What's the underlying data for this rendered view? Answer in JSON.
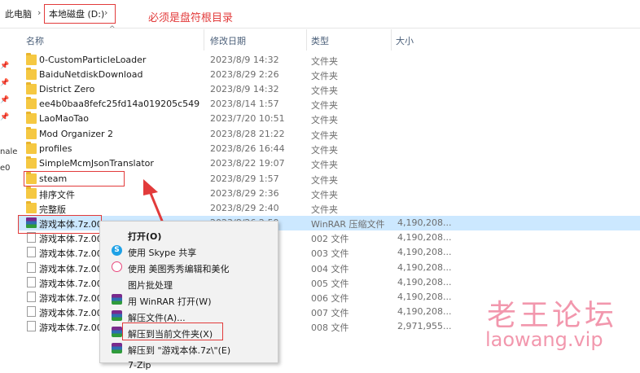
{
  "breadcrumb": {
    "items": [
      "此电脑",
      "本地磁盘 (D:)"
    ]
  },
  "annotation": {
    "note": "必须是盘符根目录"
  },
  "columns": {
    "name": "名称",
    "date": "修改日期",
    "type": "类型",
    "size": "大小"
  },
  "left_nav": {
    "text_1": "nale",
    "text_2": "e0"
  },
  "files": [
    {
      "name": "0-CustomParticleLoader",
      "date": "2023/8/9 14:32",
      "type": "文件夹",
      "size": "",
      "icon": "folder-icon"
    },
    {
      "name": "BaiduNetdiskDownload",
      "date": "2023/8/29 2:26",
      "type": "文件夹",
      "size": "",
      "icon": "folder-icon"
    },
    {
      "name": "District Zero",
      "date": "2023/8/9 14:32",
      "type": "文件夹",
      "size": "",
      "icon": "folder-icon"
    },
    {
      "name": "ee4b0baa8fefc25fd14a019205c549",
      "date": "2023/8/14 1:57",
      "type": "文件夹",
      "size": "",
      "icon": "folder-icon"
    },
    {
      "name": "LaoMaoTao",
      "date": "2023/7/20 10:51",
      "type": "文件夹",
      "size": "",
      "icon": "folder-icon"
    },
    {
      "name": "Mod Organizer 2",
      "date": "2023/8/28 21:22",
      "type": "文件夹",
      "size": "",
      "icon": "folder-icon"
    },
    {
      "name": "profiles",
      "date": "2023/8/26 16:44",
      "type": "文件夹",
      "size": "",
      "icon": "folder-icon"
    },
    {
      "name": "SimpleMcmJsonTranslator",
      "date": "2023/8/22 19:07",
      "type": "文件夹",
      "size": "",
      "icon": "folder-icon"
    },
    {
      "name": "steam",
      "date": "2023/8/29 1:57",
      "type": "文件夹",
      "size": "",
      "icon": "folder-icon"
    },
    {
      "name": "排序文件",
      "date": "2023/8/29 2:36",
      "type": "文件夹",
      "size": "",
      "icon": "folder-icon"
    },
    {
      "name": "完整版",
      "date": "2023/8/29 2:40",
      "type": "文件夹",
      "size": "",
      "icon": "folder-icon"
    },
    {
      "name": "游戏本体.7z.001",
      "date": "2023/8/26 2:59",
      "type": "WinRAR 压缩文件",
      "size": "4,190,208...",
      "icon": "winrar-icon",
      "selected": true
    },
    {
      "name": "游戏本体.7z.002",
      "date": "",
      "type": "002 文件",
      "size": "4,190,208...",
      "icon": "file-icon"
    },
    {
      "name": "游戏本体.7z.003",
      "date": "",
      "type": "003 文件",
      "size": "4,190,208...",
      "icon": "file-icon"
    },
    {
      "name": "游戏本体.7z.004",
      "date": "",
      "type": "004 文件",
      "size": "4,190,208...",
      "icon": "file-icon"
    },
    {
      "name": "游戏本体.7z.005",
      "date": "",
      "type": "005 文件",
      "size": "4,190,208...",
      "icon": "file-icon"
    },
    {
      "name": "游戏本体.7z.006",
      "date": "",
      "type": "006 文件",
      "size": "4,190,208...",
      "icon": "file-icon"
    },
    {
      "name": "游戏本体.7z.007",
      "date": "",
      "type": "007 文件",
      "size": "4,190,208...",
      "icon": "file-icon"
    },
    {
      "name": "游戏本体.7z.008",
      "date": "",
      "type": "008 文件",
      "size": "2,971,955...",
      "icon": "file-icon"
    }
  ],
  "context_menu": {
    "items": [
      {
        "label": "打开(O)",
        "icon": "",
        "bold": true
      },
      {
        "label": "使用 Skype 共享",
        "icon": "skype-icon"
      },
      {
        "label": "使用 美图秀秀编辑和美化",
        "icon": "meitu-icon"
      },
      {
        "label": "图片批处理",
        "icon": ""
      },
      {
        "label": "用 WinRAR 打开(W)",
        "icon": "winrar-icon"
      },
      {
        "label": "解压文件(A)...",
        "icon": "winrar-icon"
      },
      {
        "label": "解压到当前文件夹(X)",
        "icon": "winrar-icon"
      },
      {
        "label": "解压到 \"游戏本体.7z\\\"(E)",
        "icon": "winrar-icon"
      },
      {
        "label": "7-Zip",
        "icon": ""
      }
    ]
  },
  "watermark": {
    "line1": "老王论坛",
    "line2": "laowang.vip"
  },
  "colors": {
    "accent_red": "#e23b3b",
    "selection": "#cce8ff",
    "watermark": "#e8436b"
  }
}
